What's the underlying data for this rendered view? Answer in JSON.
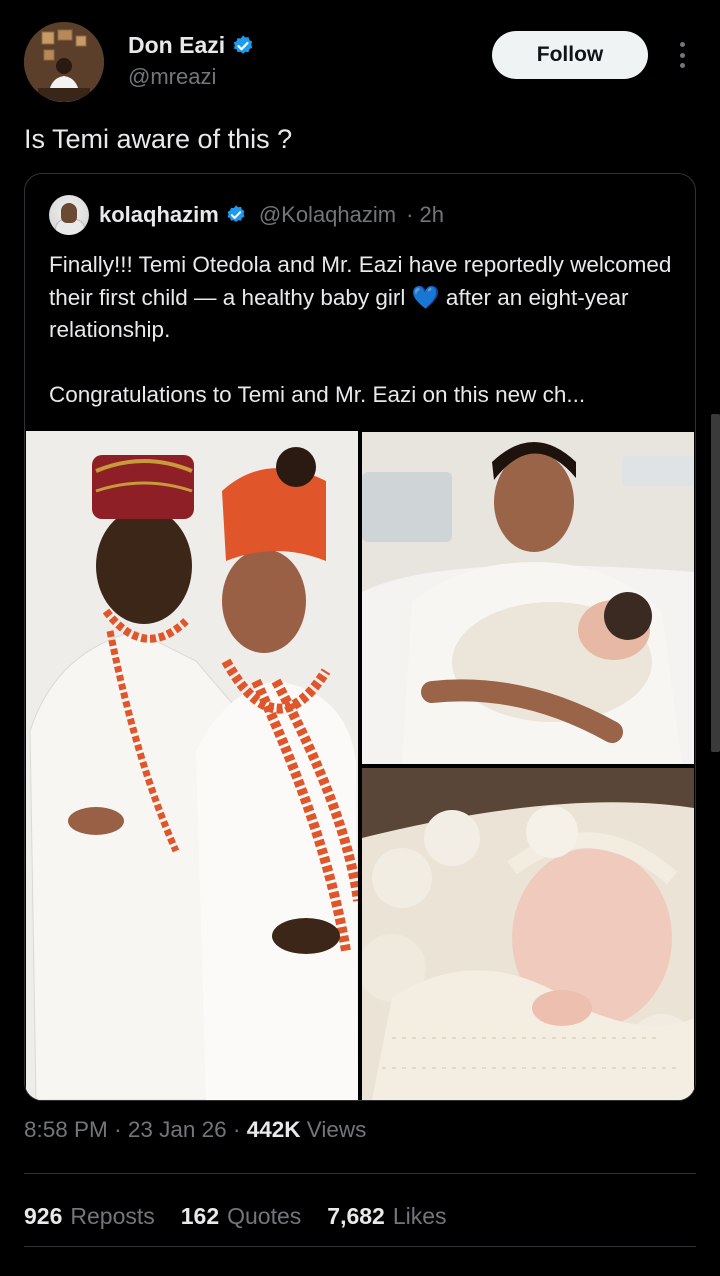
{
  "author": {
    "display_name": "Don Eazi",
    "handle": "@mreazi",
    "verified_icon": "verified-badge-icon",
    "follow_label": "Follow"
  },
  "tweet": {
    "text": "Is Temi aware of this ?"
  },
  "quoted": {
    "display_name": "kolaqhazim",
    "handle": "@Kolaqhazim",
    "time": "· 2h",
    "paragraph_1": "Finally!!! Temi Otedola and Mr. Eazi have reportedly welcomed their first child — a healthy baby girl 💙 after an eight-year relationship.",
    "paragraph_2": "Congratulations to Temi and Mr. Eazi on this new ch..."
  },
  "meta": {
    "time": "8:58 PM",
    "date": "23 Jan 26",
    "views_count": "442K",
    "views_label": "Views",
    "sep": "·"
  },
  "stats": {
    "reposts_count": "926",
    "reposts_label": "Reposts",
    "quotes_count": "162",
    "quotes_label": "Quotes",
    "likes_count": "7,682",
    "likes_label": "Likes"
  },
  "colors": {
    "background": "#000000",
    "text": "#e7e9ea",
    "secondary": "#71767b",
    "verified": "#1d9bf0",
    "border": "#2f3336"
  }
}
